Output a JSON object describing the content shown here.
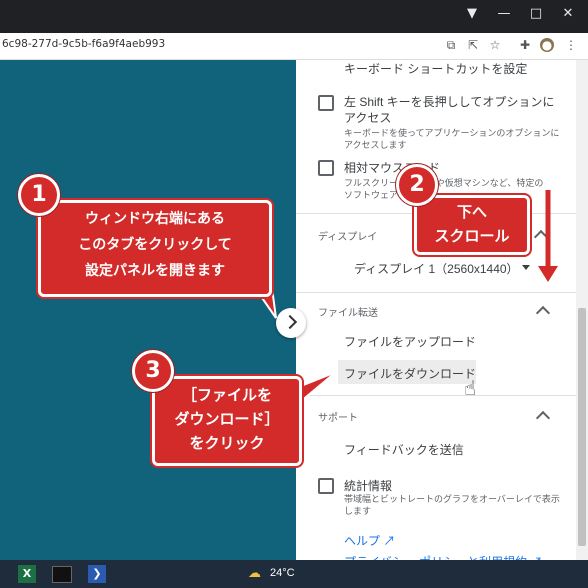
{
  "browser": {
    "url": "6c98-277d-9c5b-f6a9f4aeb993",
    "window_buttons": [
      "—",
      "□",
      "✕"
    ]
  },
  "panel": {
    "top_partial": "キーボード ショートカットを設定",
    "opt_shift": {
      "title1": "左 Shift キーを長押ししてオプションに",
      "title2": "アクセス",
      "desc1": "キーボードを使ってアプリケーションのオプションに",
      "desc2": "アクセスします"
    },
    "opt_mouse": {
      "title": "相対マウスモード",
      "desc1": "フルスクリーン ゲームや仮想マシンなど、特定の",
      "desc2": "ソフトウェアと"
    },
    "display_section": "ディスプレイ",
    "display_value": "ディスプレイ 1（2560x1440）",
    "file_section": "ファイル転送",
    "upload": "ファイルをアップロード",
    "download": "ファイルをダウンロード",
    "support_section": "サポート",
    "feedback": "フィードバックを送信",
    "stats_title": "統計情報",
    "stats_desc": "帯域幅とビットレートのグラフをオーバーレイで表示",
    "stats_desc2": "します",
    "help": "ヘルプ",
    "privacy": "プライバシー ポリシーと利用規約"
  },
  "callouts": {
    "c1": {
      "num": "1",
      "lines": [
        "ウィンドウ右端にある",
        "このタブをクリックして",
        "設定パネルを開きます"
      ]
    },
    "c2": {
      "num": "2",
      "lines": [
        "下へ",
        "スクロール"
      ]
    },
    "c3": {
      "num": "3",
      "lines": [
        "［ファイルを",
        "ダウンロード］",
        "をクリック"
      ]
    }
  },
  "taskbar": {
    "weather": "24°C"
  },
  "colors": {
    "callout": "#d32a2a",
    "remote_bg": "#11637b",
    "link": "#1a73e8"
  }
}
